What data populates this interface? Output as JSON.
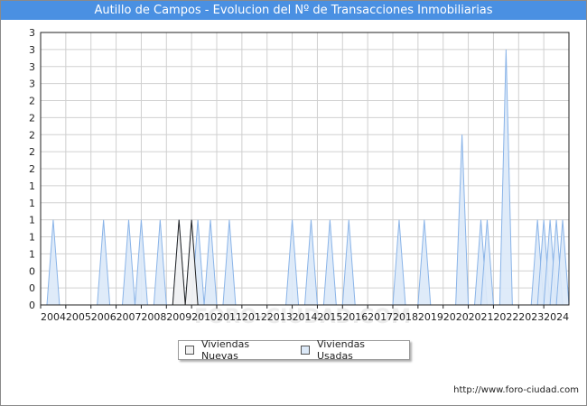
{
  "title": "Autillo de Campos - Evolucion del Nº de Transacciones Inmobiliarias",
  "footer": "http://www.foro-ciudad.com",
  "watermark": "FORO-CIUDAD.COM",
  "colors": {
    "header": "#4a90e2",
    "nuevas_fill": "#f2f2f2",
    "nuevas_stroke": "#222222",
    "usadas_fill": "#dce9f8",
    "usadas_stroke": "#8ab4e8",
    "grid": "#d0d0d0"
  },
  "chart_data": {
    "type": "area",
    "xlabel": "",
    "ylabel": "",
    "x_tick_labels": [
      "2004",
      "2005",
      "2006",
      "2007",
      "2008",
      "2009",
      "2010",
      "2011",
      "2012",
      "2013",
      "2014",
      "2015",
      "2016",
      "2017",
      "2018",
      "2019",
      "2020",
      "2021",
      "2022",
      "2023",
      "2024"
    ],
    "y_tick_labels": [
      "0",
      "0",
      "0",
      "1",
      "1",
      "1",
      "1",
      "1",
      "2",
      "2",
      "2",
      "2",
      "2",
      "3",
      "3",
      "3",
      "3"
    ],
    "xlim": [
      2004,
      2025
    ],
    "ylim": [
      0,
      3.2
    ],
    "grid": true,
    "legend_position": "bottom-center",
    "series": [
      {
        "name": "Viviendas Nuevas",
        "points": [
          [
            2009.5,
            1
          ],
          [
            2010.0,
            1
          ]
        ]
      },
      {
        "name": "Viviendas Usadas",
        "points": [
          [
            2004.5,
            1
          ],
          [
            2006.5,
            1
          ],
          [
            2007.5,
            1
          ],
          [
            2008.0,
            1
          ],
          [
            2008.75,
            1
          ],
          [
            2009.5,
            1
          ],
          [
            2010.0,
            1
          ],
          [
            2010.25,
            1
          ],
          [
            2010.75,
            1
          ],
          [
            2011.5,
            1
          ],
          [
            2014.0,
            1
          ],
          [
            2014.75,
            1
          ],
          [
            2015.5,
            1
          ],
          [
            2016.25,
            1
          ],
          [
            2018.25,
            1
          ],
          [
            2019.25,
            1
          ],
          [
            2020.75,
            2
          ],
          [
            2021.5,
            1
          ],
          [
            2021.75,
            1
          ],
          [
            2022.5,
            3
          ],
          [
            2023.75,
            1
          ],
          [
            2024.0,
            1
          ],
          [
            2024.25,
            1
          ],
          [
            2024.5,
            1
          ],
          [
            2024.75,
            1
          ]
        ]
      }
    ]
  }
}
